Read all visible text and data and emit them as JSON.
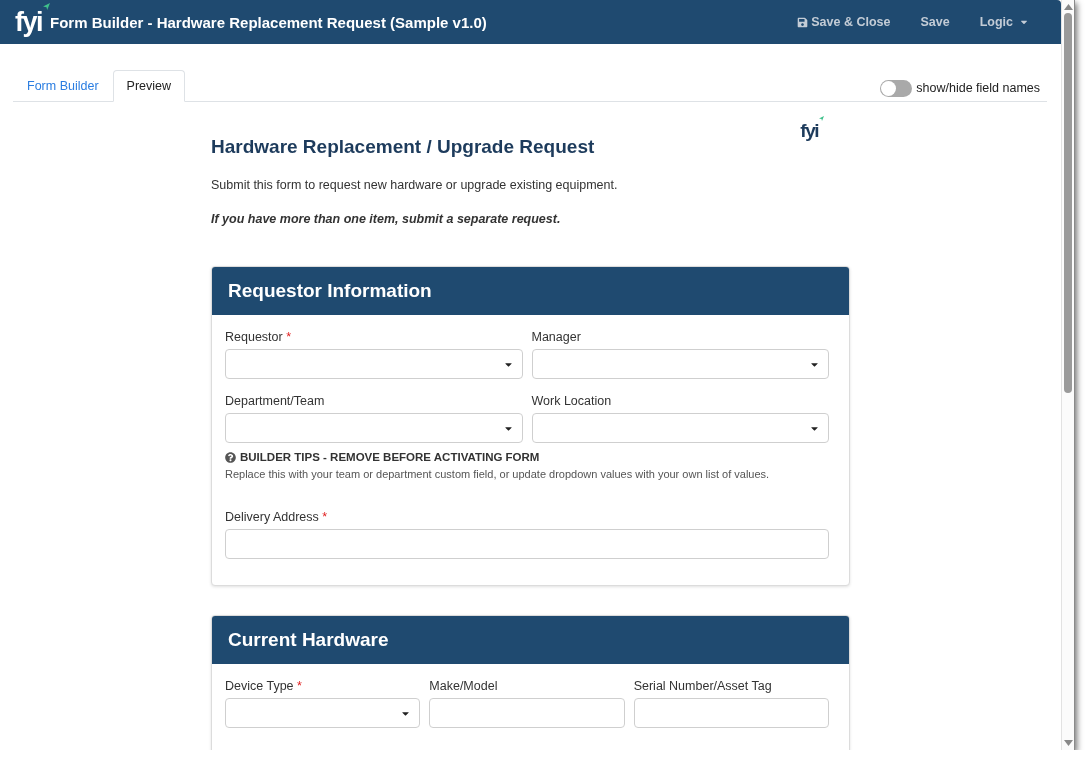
{
  "header": {
    "logo": "fyi",
    "title": "Form Builder - Hardware Replacement Request (Sample v1.0)",
    "actions": [
      {
        "kind": "save",
        "label": "Save & Close"
      },
      {
        "kind": "link",
        "label": "Save"
      },
      {
        "kind": "menu",
        "label": "Logic"
      }
    ]
  },
  "tabs": [
    {
      "label": "Form Builder",
      "selected": false
    },
    {
      "label": "Preview",
      "selected": true
    }
  ],
  "field_names_toggle": {
    "label": "show/hide field names",
    "on": false
  },
  "form": {
    "logo": "fyi",
    "title": "Hardware Replacement / Upgrade Request",
    "intro": "Submit this form to request new hardware or upgrade existing equipment.",
    "note": "If you have more than one item, submit a separate request.",
    "required_marker": "*",
    "sections": [
      {
        "title": "Requestor Information",
        "rows": [
          {
            "kind": "fields",
            "fields": [
              {
                "label": "Requestor",
                "required": true,
                "kind": "dropdown"
              },
              {
                "label": "Manager",
                "required": false,
                "kind": "dropdown"
              }
            ]
          },
          {
            "kind": "fields",
            "fields": [
              {
                "label": "Department/Team",
                "required": false,
                "kind": "dropdown"
              },
              {
                "label": "Work Location",
                "required": false,
                "kind": "dropdown"
              }
            ]
          },
          {
            "kind": "tip",
            "heading": "BUILDER TIPS - REMOVE BEFORE ACTIVATING FORM",
            "text": "Replace this with your team or department custom field, or update dropdown values with your own list of values."
          },
          {
            "kind": "fields",
            "fields": [
              {
                "label": "Delivery Address",
                "required": true,
                "kind": "text"
              }
            ]
          }
        ]
      },
      {
        "title": "Current Hardware",
        "rows": [
          {
            "kind": "fields",
            "fields": [
              {
                "label": "Device Type",
                "required": true,
                "kind": "dropdown"
              },
              {
                "label": "Make/Model",
                "required": false,
                "kind": "text"
              },
              {
                "label": "Serial Number/Asset Tag",
                "required": false,
                "kind": "text"
              }
            ]
          }
        ]
      }
    ]
  }
}
